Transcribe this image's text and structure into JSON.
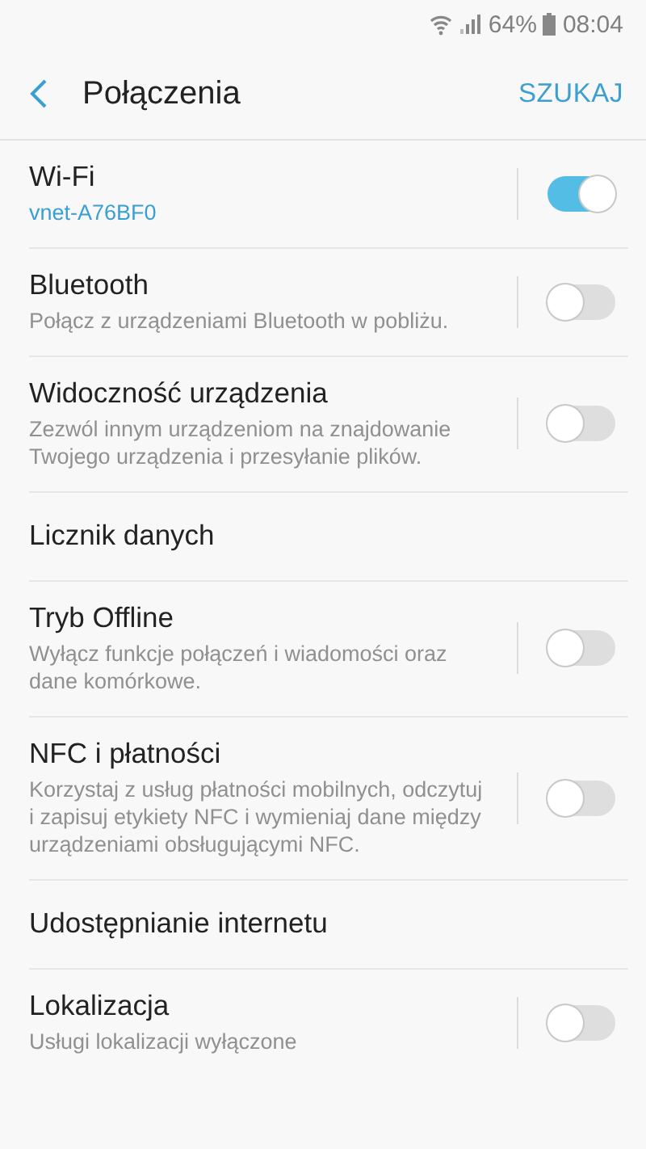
{
  "status_bar": {
    "battery": "64%",
    "time": "08:04"
  },
  "header": {
    "title": "Połączenia",
    "action": "SZUKAJ"
  },
  "settings": [
    {
      "kind": "switch",
      "title": "Wi-Fi",
      "status": "vnet-A76BF0",
      "on": true
    },
    {
      "kind": "switch",
      "title": "Bluetooth",
      "description": "Połącz z urządzeniami Bluetooth w pobliżu.",
      "on": false
    },
    {
      "kind": "switch",
      "title": "Widoczność urządzenia",
      "description": "Zezwól innym urządzeniom na znajdowanie Twojego urządzenia i przesyłanie plików.",
      "on": false
    },
    {
      "kind": "link",
      "title": "Licznik danych"
    },
    {
      "kind": "switch",
      "title": "Tryb Offline",
      "description": "Wyłącz funkcje połączeń i wiadomości oraz dane komórkowe.",
      "on": false
    },
    {
      "kind": "switch",
      "title": "NFC i płatności",
      "description": "Korzystaj z usług płatności mobilnych, odczytuj i zapisuj etykiety NFC i wymieniaj dane między urządzeniami obsługującymi NFC.",
      "on": false
    },
    {
      "kind": "link",
      "title": "Udostępnianie internetu"
    },
    {
      "kind": "switch",
      "title": "Lokalizacja",
      "description": "Usługi lokalizacji wyłączone",
      "on": false
    }
  ]
}
